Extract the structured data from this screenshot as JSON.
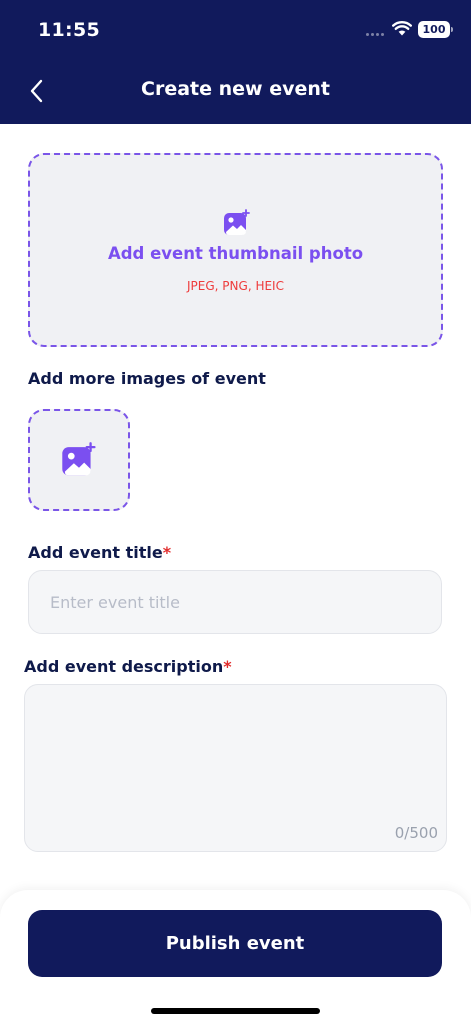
{
  "status_bar": {
    "time": "11:55",
    "battery": "100"
  },
  "header": {
    "title": "Create new event",
    "back_icon": "chevron-left-icon"
  },
  "thumbnail": {
    "icon": "image-add-icon",
    "label": "Add event thumbnail photo",
    "hint": "JPEG, PNG, HEIC"
  },
  "more_images": {
    "label": "Add more images of event",
    "icon": "image-add-icon"
  },
  "event_title": {
    "label": "Add event title",
    "required_mark": "*",
    "value": "",
    "placeholder": "Enter event title"
  },
  "event_description": {
    "label": "Add event description",
    "required_mark": "*",
    "value": "",
    "counter": "0/500"
  },
  "footer": {
    "publish_label": "Publish event"
  },
  "colors": {
    "header_bg": "#111a5c",
    "accent_purple": "#7b4ff0",
    "hint_red": "#ee3b3b",
    "required_red": "#e12b2b"
  }
}
